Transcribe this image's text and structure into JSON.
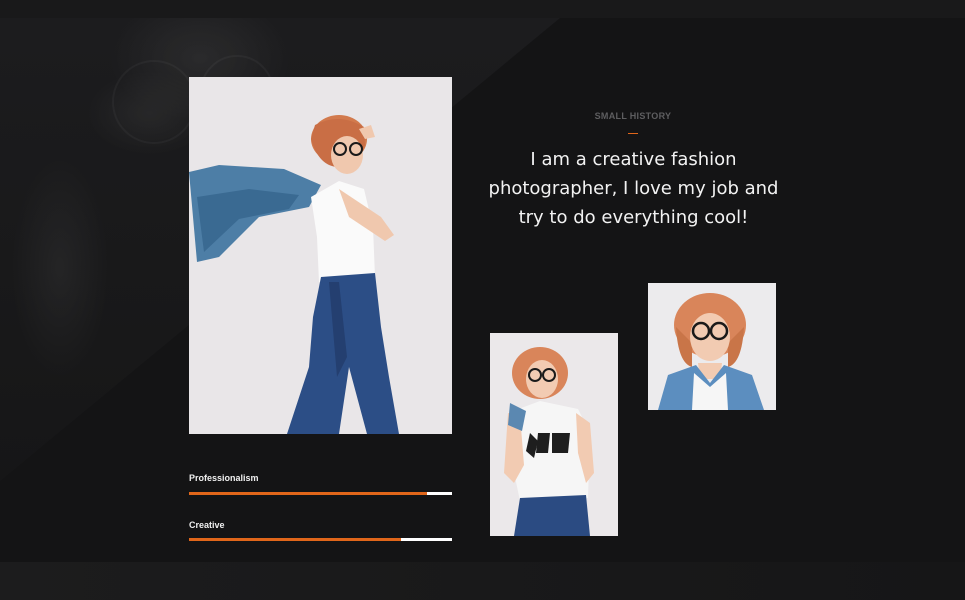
{
  "section": {
    "eyebrow": "SMALL HISTORY",
    "headline": "I am a creative fashion photographer, I love my job and try to do everything cool!"
  },
  "skills": [
    {
      "label": "Professionalism",
      "value": 0.905
    },
    {
      "label": "Creative",
      "value": 0.805
    }
  ],
  "colors": {
    "background": "#141415",
    "accent": "#e0661a",
    "track": "#ffffff",
    "text": "#f2f2f2",
    "muted": "#5e5e60"
  }
}
